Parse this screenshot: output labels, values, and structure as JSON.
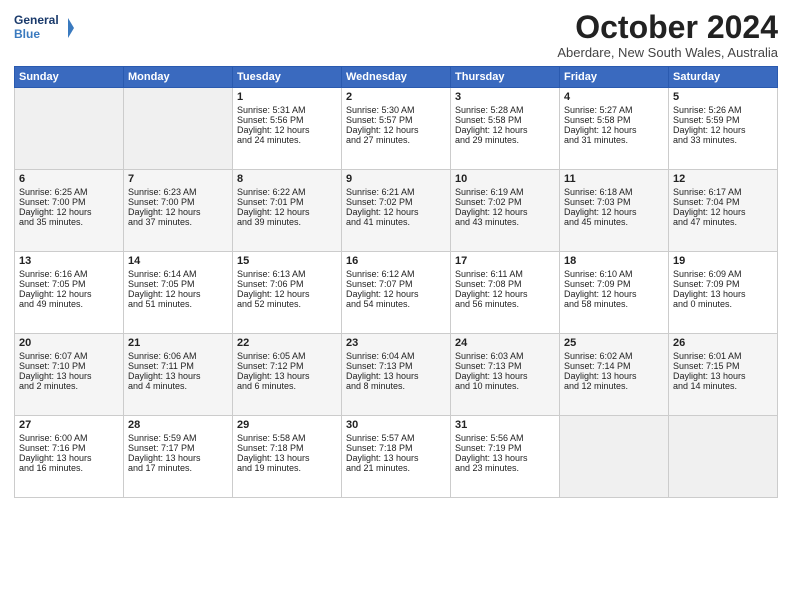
{
  "logo": {
    "line1": "General",
    "line2": "Blue"
  },
  "title": "October 2024",
  "subtitle": "Aberdare, New South Wales, Australia",
  "header_days": [
    "Sunday",
    "Monday",
    "Tuesday",
    "Wednesday",
    "Thursday",
    "Friday",
    "Saturday"
  ],
  "weeks": [
    [
      {
        "day": "",
        "content": ""
      },
      {
        "day": "",
        "content": ""
      },
      {
        "day": "1",
        "content": "Sunrise: 5:31 AM\nSunset: 5:56 PM\nDaylight: 12 hours\nand 24 minutes."
      },
      {
        "day": "2",
        "content": "Sunrise: 5:30 AM\nSunset: 5:57 PM\nDaylight: 12 hours\nand 27 minutes."
      },
      {
        "day": "3",
        "content": "Sunrise: 5:28 AM\nSunset: 5:58 PM\nDaylight: 12 hours\nand 29 minutes."
      },
      {
        "day": "4",
        "content": "Sunrise: 5:27 AM\nSunset: 5:58 PM\nDaylight: 12 hours\nand 31 minutes."
      },
      {
        "day": "5",
        "content": "Sunrise: 5:26 AM\nSunset: 5:59 PM\nDaylight: 12 hours\nand 33 minutes."
      }
    ],
    [
      {
        "day": "6",
        "content": "Sunrise: 6:25 AM\nSunset: 7:00 PM\nDaylight: 12 hours\nand 35 minutes."
      },
      {
        "day": "7",
        "content": "Sunrise: 6:23 AM\nSunset: 7:00 PM\nDaylight: 12 hours\nand 37 minutes."
      },
      {
        "day": "8",
        "content": "Sunrise: 6:22 AM\nSunset: 7:01 PM\nDaylight: 12 hours\nand 39 minutes."
      },
      {
        "day": "9",
        "content": "Sunrise: 6:21 AM\nSunset: 7:02 PM\nDaylight: 12 hours\nand 41 minutes."
      },
      {
        "day": "10",
        "content": "Sunrise: 6:19 AM\nSunset: 7:02 PM\nDaylight: 12 hours\nand 43 minutes."
      },
      {
        "day": "11",
        "content": "Sunrise: 6:18 AM\nSunset: 7:03 PM\nDaylight: 12 hours\nand 45 minutes."
      },
      {
        "day": "12",
        "content": "Sunrise: 6:17 AM\nSunset: 7:04 PM\nDaylight: 12 hours\nand 47 minutes."
      }
    ],
    [
      {
        "day": "13",
        "content": "Sunrise: 6:16 AM\nSunset: 7:05 PM\nDaylight: 12 hours\nand 49 minutes."
      },
      {
        "day": "14",
        "content": "Sunrise: 6:14 AM\nSunset: 7:05 PM\nDaylight: 12 hours\nand 51 minutes."
      },
      {
        "day": "15",
        "content": "Sunrise: 6:13 AM\nSunset: 7:06 PM\nDaylight: 12 hours\nand 52 minutes."
      },
      {
        "day": "16",
        "content": "Sunrise: 6:12 AM\nSunset: 7:07 PM\nDaylight: 12 hours\nand 54 minutes."
      },
      {
        "day": "17",
        "content": "Sunrise: 6:11 AM\nSunset: 7:08 PM\nDaylight: 12 hours\nand 56 minutes."
      },
      {
        "day": "18",
        "content": "Sunrise: 6:10 AM\nSunset: 7:09 PM\nDaylight: 12 hours\nand 58 minutes."
      },
      {
        "day": "19",
        "content": "Sunrise: 6:09 AM\nSunset: 7:09 PM\nDaylight: 13 hours\nand 0 minutes."
      }
    ],
    [
      {
        "day": "20",
        "content": "Sunrise: 6:07 AM\nSunset: 7:10 PM\nDaylight: 13 hours\nand 2 minutes."
      },
      {
        "day": "21",
        "content": "Sunrise: 6:06 AM\nSunset: 7:11 PM\nDaylight: 13 hours\nand 4 minutes."
      },
      {
        "day": "22",
        "content": "Sunrise: 6:05 AM\nSunset: 7:12 PM\nDaylight: 13 hours\nand 6 minutes."
      },
      {
        "day": "23",
        "content": "Sunrise: 6:04 AM\nSunset: 7:13 PM\nDaylight: 13 hours\nand 8 minutes."
      },
      {
        "day": "24",
        "content": "Sunrise: 6:03 AM\nSunset: 7:13 PM\nDaylight: 13 hours\nand 10 minutes."
      },
      {
        "day": "25",
        "content": "Sunrise: 6:02 AM\nSunset: 7:14 PM\nDaylight: 13 hours\nand 12 minutes."
      },
      {
        "day": "26",
        "content": "Sunrise: 6:01 AM\nSunset: 7:15 PM\nDaylight: 13 hours\nand 14 minutes."
      }
    ],
    [
      {
        "day": "27",
        "content": "Sunrise: 6:00 AM\nSunset: 7:16 PM\nDaylight: 13 hours\nand 16 minutes."
      },
      {
        "day": "28",
        "content": "Sunrise: 5:59 AM\nSunset: 7:17 PM\nDaylight: 13 hours\nand 17 minutes."
      },
      {
        "day": "29",
        "content": "Sunrise: 5:58 AM\nSunset: 7:18 PM\nDaylight: 13 hours\nand 19 minutes."
      },
      {
        "day": "30",
        "content": "Sunrise: 5:57 AM\nSunset: 7:18 PM\nDaylight: 13 hours\nand 21 minutes."
      },
      {
        "day": "31",
        "content": "Sunrise: 5:56 AM\nSunset: 7:19 PM\nDaylight: 13 hours\nand 23 minutes."
      },
      {
        "day": "",
        "content": ""
      },
      {
        "day": "",
        "content": ""
      }
    ]
  ]
}
